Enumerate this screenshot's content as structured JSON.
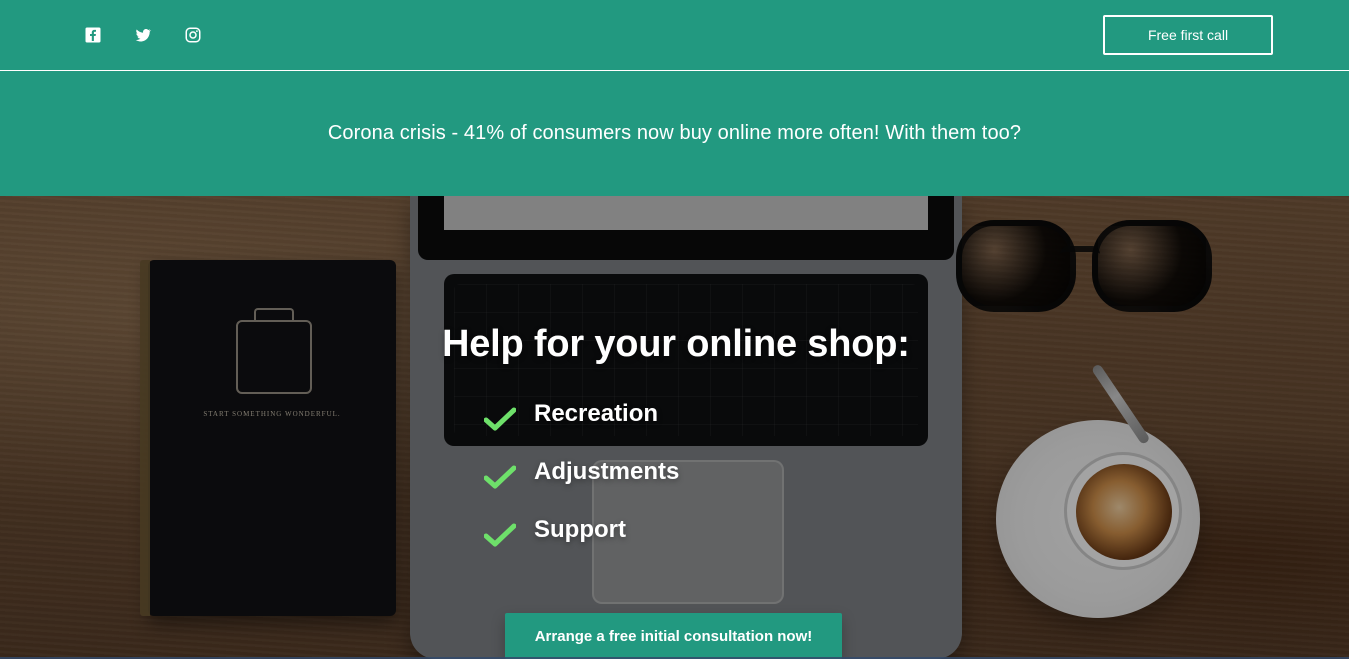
{
  "header": {
    "social": [
      {
        "name": "facebook-icon"
      },
      {
        "name": "twitter-icon"
      },
      {
        "name": "instagram-icon"
      }
    ],
    "cta_label": "Free first call"
  },
  "banner": {
    "text": "Corona crisis - 41% of consumers now buy online more often! With them too?"
  },
  "hero": {
    "title": "Help for your online shop:",
    "items": [
      {
        "label": "Recreation"
      },
      {
        "label": "Adjustments"
      },
      {
        "label": "Support"
      }
    ],
    "cta_label": "Arrange a free initial consultation now!"
  },
  "decor": {
    "notebook_text": "START SOMETHING WONDERFUL."
  },
  "colors": {
    "primary": "#229980",
    "check": "#6ee06a",
    "text": "#ffffff"
  }
}
